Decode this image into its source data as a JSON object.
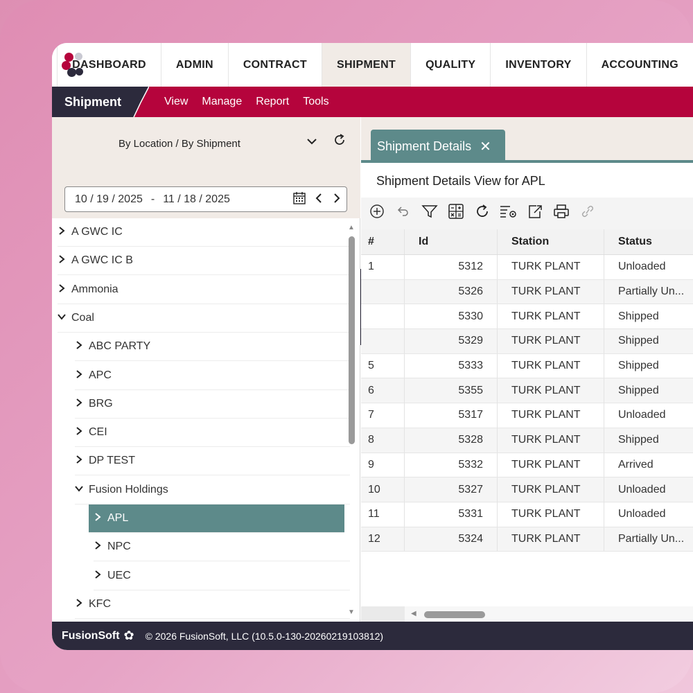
{
  "nav": {
    "tabs": [
      "DASHBOARD",
      "ADMIN",
      "CONTRACT",
      "SHIPMENT",
      "QUALITY",
      "INVENTORY",
      "ACCOUNTING"
    ],
    "active": "SHIPMENT"
  },
  "subbar": {
    "module": "Shipment",
    "menu": [
      "View",
      "Manage",
      "Report",
      "Tools"
    ]
  },
  "left": {
    "selector": "By Location / By Shipment",
    "date_start": "10 / 19 / 2025",
    "date_sep": "-",
    "date_end": "11 / 18 / 2025",
    "tree": [
      {
        "label": "A GWC IC",
        "level": 0,
        "state": "collapsed"
      },
      {
        "label": "A GWC IC B",
        "level": 0,
        "state": "collapsed"
      },
      {
        "label": "Ammonia",
        "level": 0,
        "state": "collapsed"
      },
      {
        "label": "Coal",
        "level": 0,
        "state": "expanded"
      },
      {
        "label": "ABC PARTY",
        "level": 1,
        "state": "collapsed"
      },
      {
        "label": "APC",
        "level": 1,
        "state": "collapsed"
      },
      {
        "label": "BRG",
        "level": 1,
        "state": "collapsed"
      },
      {
        "label": "CEI",
        "level": 1,
        "state": "collapsed"
      },
      {
        "label": "DP TEST",
        "level": 1,
        "state": "collapsed"
      },
      {
        "label": "Fusion Holdings",
        "level": 1,
        "state": "expanded"
      },
      {
        "label": "APL",
        "level": 2,
        "state": "collapsed",
        "selected": true
      },
      {
        "label": "NPC",
        "level": 2,
        "state": "collapsed"
      },
      {
        "label": "UEC",
        "level": 2,
        "state": "collapsed"
      },
      {
        "label": "KFC",
        "level": 1,
        "state": "collapsed"
      }
    ]
  },
  "right": {
    "tab_label": "Shipment Details",
    "view_title": "Shipment Details View for APL",
    "toolbar_icons": [
      "add-icon",
      "undo-icon",
      "filter-icon",
      "calculator-icon",
      "refresh-icon",
      "column-settings-icon",
      "export-icon",
      "print-icon",
      "link-icon"
    ],
    "columns": [
      "#",
      "Id",
      "Station",
      "Status"
    ],
    "rows": [
      {
        "num": "1",
        "id": "5312",
        "station": "TURK PLANT",
        "status": "Unloaded"
      },
      {
        "num": "",
        "id": "5326",
        "station": "TURK PLANT",
        "status": "Partially Un..."
      },
      {
        "num": "",
        "id": "5330",
        "station": "TURK PLANT",
        "status": "Shipped"
      },
      {
        "num": "",
        "id": "5329",
        "station": "TURK PLANT",
        "status": "Shipped"
      },
      {
        "num": "5",
        "id": "5333",
        "station": "TURK PLANT",
        "status": "Shipped"
      },
      {
        "num": "6",
        "id": "5355",
        "station": "TURK PLANT",
        "status": "Shipped"
      },
      {
        "num": "7",
        "id": "5317",
        "station": "TURK PLANT",
        "status": "Unloaded"
      },
      {
        "num": "8",
        "id": "5328",
        "station": "TURK PLANT",
        "status": "Shipped"
      },
      {
        "num": "9",
        "id": "5332",
        "station": "TURK PLANT",
        "status": "Arrived"
      },
      {
        "num": "10",
        "id": "5327",
        "station": "TURK PLANT",
        "status": "Unloaded"
      },
      {
        "num": "11",
        "id": "5331",
        "station": "TURK PLANT",
        "status": "Unloaded"
      },
      {
        "num": "12",
        "id": "5324",
        "station": "TURK PLANT",
        "status": "Partially Un..."
      }
    ]
  },
  "footer": {
    "brand": "FusionSoft",
    "copyright": "© 2026 FusionSoft, LLC (10.5.0-130-20260219103812)"
  },
  "colors": {
    "accent_red": "#b5043c",
    "dark": "#2c2a3c",
    "teal": "#5d8a8a",
    "panel_beige": "#f1ebe6"
  }
}
